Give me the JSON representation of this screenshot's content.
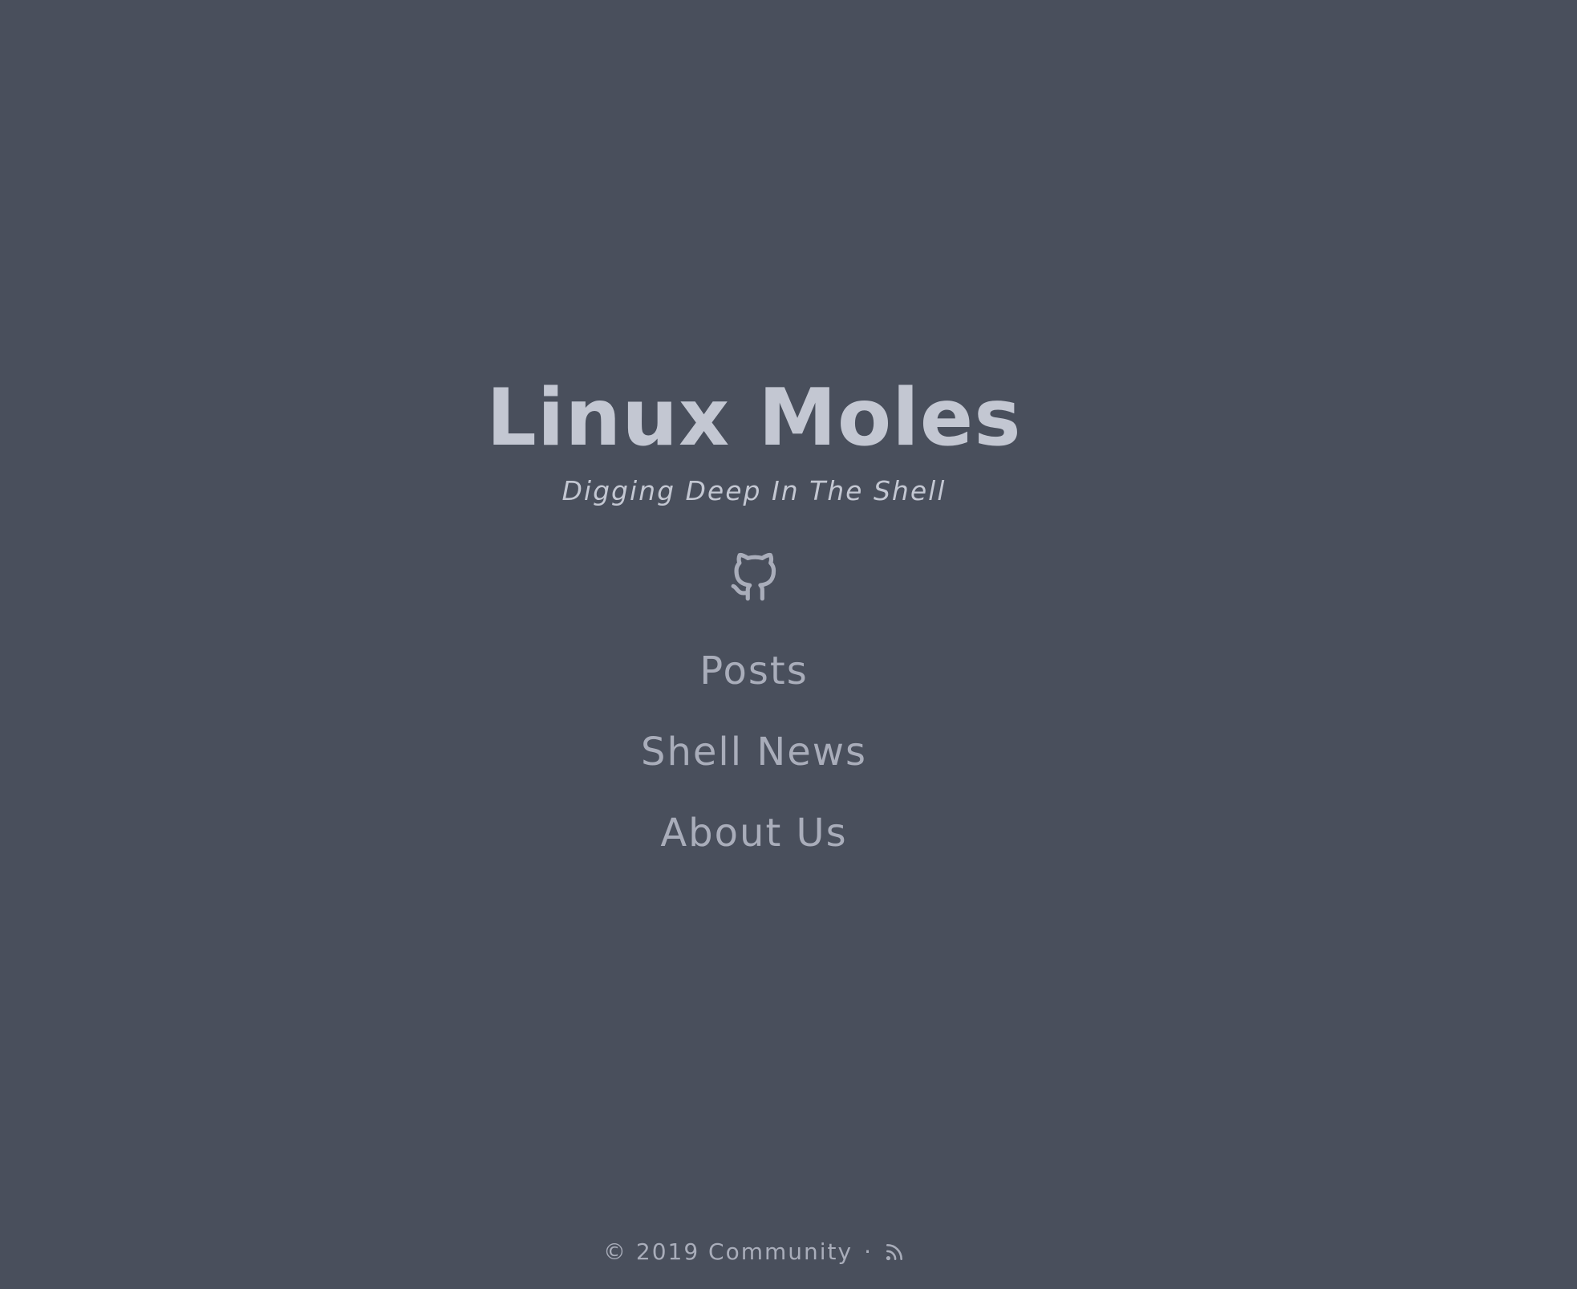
{
  "header": {
    "title": "Linux Moles",
    "subtitle": "Digging Deep In The Shell"
  },
  "social": {
    "icon": "github-icon"
  },
  "nav": {
    "items": [
      {
        "label": "Posts"
      },
      {
        "label": "Shell News"
      },
      {
        "label": "About Us"
      }
    ]
  },
  "footer": {
    "copyright": "© 2019 Community",
    "separator": "·",
    "rss_icon": "rss-icon"
  },
  "colors": {
    "background": "#494f5c",
    "title": "#c3c7d2",
    "text": "#a9adba"
  }
}
